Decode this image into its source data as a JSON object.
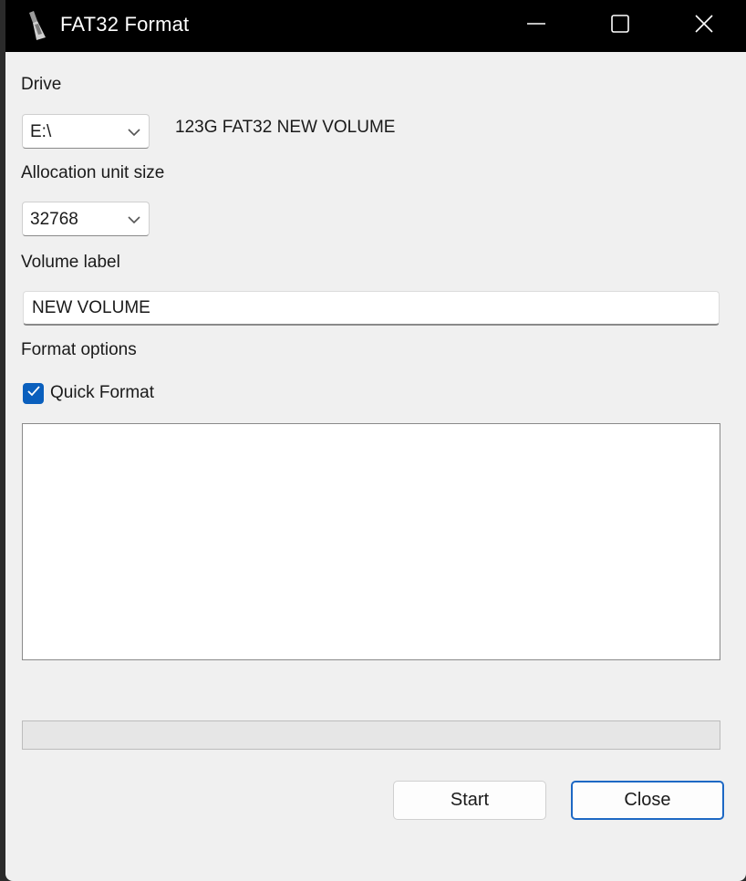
{
  "window": {
    "title": "FAT32 Format",
    "accent_color": "#0a5fbd",
    "titlebar_color": "#000000",
    "icons": [
      "app-icon",
      "minimize-icon",
      "maximize-icon",
      "close-icon"
    ]
  },
  "drive": {
    "label": "Drive",
    "selected": "E:\\",
    "info": "123G FAT32 NEW VOLUME"
  },
  "allocation": {
    "label": "Allocation unit size",
    "selected": "32768"
  },
  "volume": {
    "label": "Volume label",
    "value": "NEW VOLUME"
  },
  "format_options": {
    "label": "Format options",
    "quick_format_label": "Quick Format",
    "quick_format_checked": true
  },
  "log": {
    "text": ""
  },
  "progress": {
    "fraction": 0
  },
  "buttons": {
    "start_label": "Start",
    "close_label": "Close"
  }
}
